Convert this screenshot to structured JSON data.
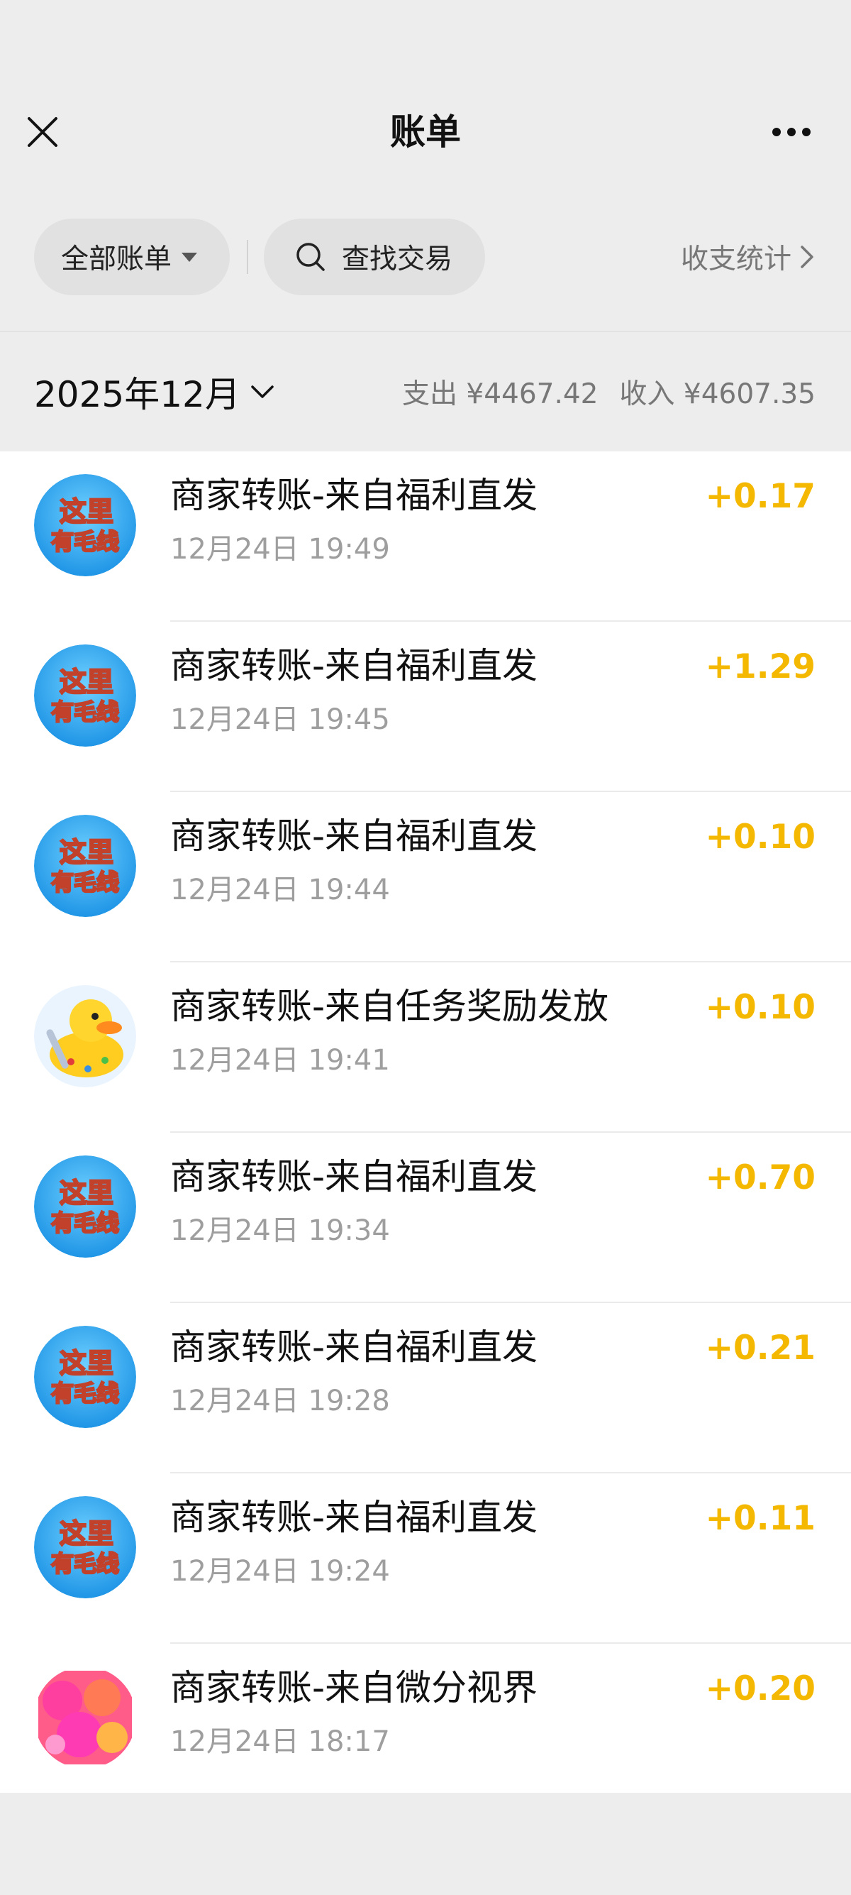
{
  "header": {
    "title": "账单"
  },
  "filters": {
    "all_bills_label": "全部账单",
    "search_label": "查找交易",
    "stats_label": "收支统计"
  },
  "month_bar": {
    "month_label": "2025年12月",
    "expense_label": "支出 ¥4467.42",
    "income_label": "收入 ¥4607.35"
  },
  "transactions": [
    {
      "title": "商家转账-来自福利直发",
      "time": "12月24日 19:49",
      "amount": "+0.17",
      "icon": "maoxian-badge-icon"
    },
    {
      "title": "商家转账-来自福利直发",
      "time": "12月24日 19:45",
      "amount": "+1.29",
      "icon": "maoxian-badge-icon"
    },
    {
      "title": "商家转账-来自福利直发",
      "time": "12月24日 19:44",
      "amount": "+0.10",
      "icon": "maoxian-badge-icon"
    },
    {
      "title": "商家转账-来自任务奖励发放",
      "time": "12月24日 19:41",
      "amount": "+0.10",
      "icon": "duck-icon"
    },
    {
      "title": "商家转账-来自福利直发",
      "time": "12月24日 19:34",
      "amount": "+0.70",
      "icon": "maoxian-badge-icon"
    },
    {
      "title": "商家转账-来自福利直发",
      "time": "12月24日 19:28",
      "amount": "+0.21",
      "icon": "maoxian-badge-icon"
    },
    {
      "title": "商家转账-来自福利直发",
      "time": "12月24日 19:24",
      "amount": "+0.11",
      "icon": "maoxian-badge-icon"
    },
    {
      "title": "商家转账-来自微分视界",
      "time": "12月24日 18:17",
      "amount": "+0.20",
      "icon": "bubbles-app-icon"
    }
  ],
  "badge_text": {
    "line1": "这里",
    "line2": "有毛线"
  },
  "colors": {
    "amount": "#f5b800",
    "background": "#ededed",
    "badge_blue": "#2fa8ee"
  }
}
